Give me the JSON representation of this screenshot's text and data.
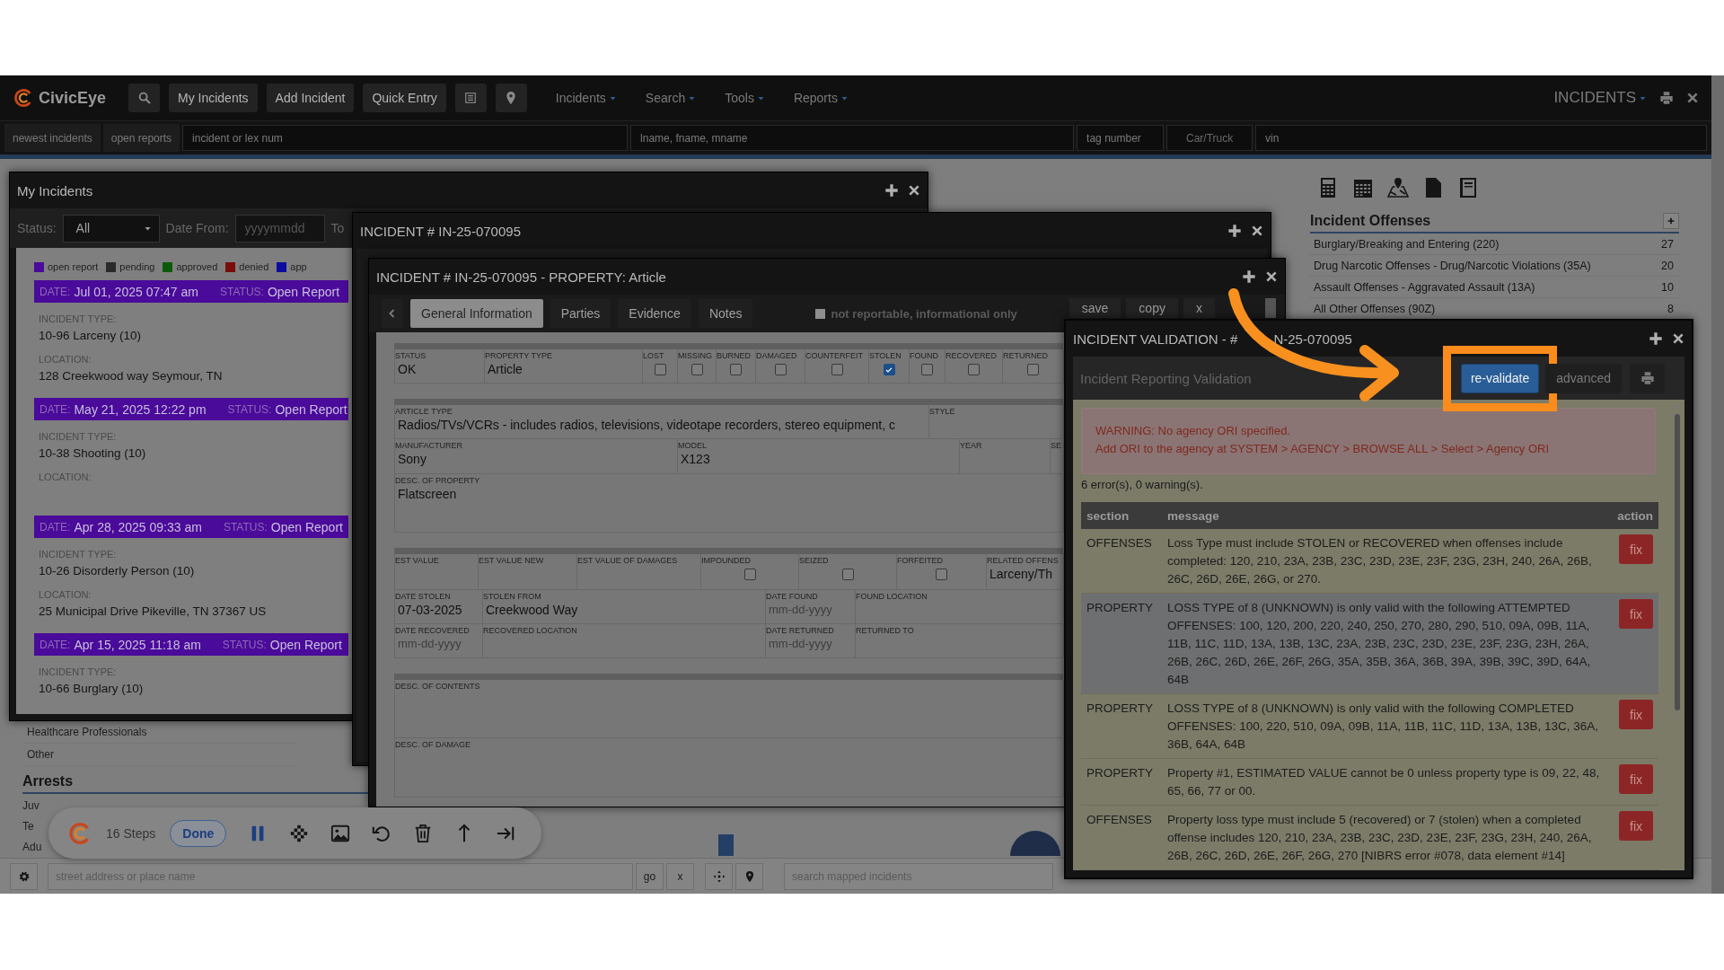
{
  "top_bar": {
    "logo": "CivicEye",
    "buttons": [
      "My Incidents",
      "Add Incident",
      "Quick Entry"
    ],
    "menus": [
      "Incidents",
      "Search",
      "Tools",
      "Reports"
    ],
    "module": "INCIDENTS"
  },
  "search_bar": [
    {
      "kind": "button",
      "label": "newest incidents"
    },
    {
      "kind": "button",
      "label": "open reports"
    },
    {
      "kind": "field",
      "placeholder": "incident or lex num"
    },
    {
      "kind": "field",
      "placeholder": "lname, fname, mname"
    },
    {
      "kind": "field",
      "placeholder": "tag number"
    },
    {
      "kind": "select",
      "label": "Car/Truck"
    },
    {
      "kind": "field",
      "placeholder": "vin"
    }
  ],
  "my_incidents": {
    "title": "My Incidents",
    "status_label": "Status:",
    "status_value": "All",
    "date_from_label": "Date From:",
    "date_from_placeholder": "yyyymmdd",
    "to_label": "To",
    "legend": [
      {
        "label": "open report",
        "color": "#4a0a9a"
      },
      {
        "label": "pending",
        "color": "#2a2a2a"
      },
      {
        "label": "approved",
        "color": "#0b5a0b"
      },
      {
        "label": "denied",
        "color": "#7a0c0c"
      },
      {
        "label": "app",
        "color": "#0c0ca0"
      }
    ],
    "incidents": [
      {
        "date_label": "DATE:",
        "date": "Jul 01, 2025 07:47 am",
        "status_label": "STATUS:",
        "status": "Open Report",
        "type_label": "INCIDENT TYPE:",
        "type": "10-96 Larceny (10)",
        "location_label": "LOCATION:",
        "location": "128 Creekwood way Seymour, TN"
      },
      {
        "date_label": "DATE:",
        "date": "May 21, 2025 12:22 pm",
        "status_label": "STATUS:",
        "status": "Open Report",
        "type_label": "INCIDENT TYPE:",
        "type": "10-38 Shooting (10)",
        "location_label": "LOCATION:"
      },
      {
        "date_label": "DATE:",
        "date": "Apr 28, 2025 09:33 am",
        "status_label": "STATUS:",
        "status": "Open Report",
        "type_label": "INCIDENT TYPE:",
        "type": "10-26 Disorderly Person (10)",
        "location_label": "LOCATION:",
        "location": "25 Municipal Drive Pikeville, TN 37367 US"
      },
      {
        "date_label": "DATE:",
        "date": "Apr 15, 2025 11:18 am",
        "status_label": "STATUS:",
        "status": "Open Report",
        "type_label": "INCIDENT TYPE:",
        "type": "10-66 Burglary (10)"
      }
    ]
  },
  "incident_window": {
    "title": "INCIDENT # IN-25-070095"
  },
  "property_window": {
    "title": "INCIDENT # IN-25-070095 - PROPERTY: Article",
    "tabs": [
      {
        "label": "General Information",
        "selected": true
      },
      {
        "label": "Parties",
        "selected": false
      },
      {
        "label": "Evidence",
        "selected": false
      },
      {
        "label": "Notes",
        "selected": false
      }
    ],
    "not_reportable": {
      "label": "not reportable, informational only",
      "checked": false
    },
    "actions": [
      "save",
      "copy",
      "x"
    ],
    "sections": [
      {
        "rows": [
          [
            {
              "kind": "text",
              "label": "STATUS",
              "value": "OK"
            },
            {
              "kind": "text",
              "label": "PROPERTY TYPE",
              "value": "Article"
            },
            {
              "kind": "checkbox",
              "label": "LOST",
              "checked": false
            },
            {
              "kind": "checkbox",
              "label": "MISSING",
              "checked": false
            },
            {
              "kind": "checkbox",
              "label": "BURNED",
              "checked": false
            },
            {
              "kind": "checkbox",
              "label": "DAMAGED",
              "checked": false
            },
            {
              "kind": "checkbox",
              "label": "COUNTERFEIT",
              "checked": false
            },
            {
              "kind": "checkbox",
              "label": "STOLEN",
              "checked": true
            },
            {
              "kind": "checkbox",
              "label": "FOUND",
              "checked": false
            },
            {
              "kind": "checkbox",
              "label": "RECOVERED",
              "checked": false
            },
            {
              "kind": "checkbox",
              "label": "RETURNED",
              "checked": false
            }
          ]
        ]
      },
      {
        "rows": [
          [
            {
              "kind": "text",
              "label": "ARTICLE TYPE",
              "value": "Radios/TVs/VCRs - includes radios, televisions, videotape recorders, stereo equipment, c"
            },
            {
              "kind": "text",
              "label": "STYLE"
            }
          ],
          [
            {
              "kind": "text",
              "label": "MANUFACTURER",
              "value": "Sony"
            },
            {
              "kind": "text",
              "label": "MODEL",
              "value": "X123"
            },
            {
              "kind": "text",
              "label": "YEAR"
            },
            {
              "kind": "text",
              "label": "SE"
            }
          ],
          [
            {
              "kind": "text",
              "label": "DESC. OF PROPERTY",
              "value": "Flatscreen"
            }
          ]
        ]
      },
      {
        "rows": [
          [
            {
              "kind": "text",
              "label": "EST VALUE"
            },
            {
              "kind": "text",
              "label": "EST VALUE NEW"
            },
            {
              "kind": "text",
              "label": "EST VALUE OF DAMAGES"
            },
            {
              "kind": "checkbox",
              "label": "IMPOUNDED",
              "checked": false
            },
            {
              "kind": "checkbox",
              "label": "SEIZED",
              "checked": false
            },
            {
              "kind": "checkbox",
              "label": "FORFEITED",
              "checked": false
            },
            {
              "kind": "text",
              "label": "RELATED OFFENS",
              "value": "Larceny/Th"
            }
          ],
          [
            {
              "kind": "text",
              "label": "DATE STOLEN",
              "value": "07-03-2025"
            },
            {
              "kind": "text",
              "label": "STOLEN FROM",
              "value": "Creekwood Way"
            },
            {
              "kind": "text",
              "label": "DATE FOUND",
              "placeholder": "mm-dd-yyyy"
            },
            {
              "kind": "text",
              "label": "FOUND LOCATION"
            }
          ],
          [
            {
              "kind": "text",
              "label": "DATE RECOVERED",
              "placeholder": "mm-dd-yyyy"
            },
            {
              "kind": "text",
              "label": "RECOVERED LOCATION"
            },
            {
              "kind": "text",
              "label": "DATE RETURNED",
              "placeholder": "mm-dd-yyyy"
            },
            {
              "kind": "text",
              "label": "RETURNED TO"
            }
          ]
        ]
      },
      {
        "rows": [
          [
            {
              "kind": "text",
              "label": "DESC. OF CONTENTS"
            }
          ],
          [
            {
              "kind": "text",
              "label": "DESC. OF DAMAGE"
            }
          ]
        ]
      }
    ]
  },
  "validation_window": {
    "title": [
      "INCIDENT VALIDATION - #",
      "N-25-070095"
    ],
    "subtitle": "Incident Reporting Validation",
    "buttons": [
      {
        "label": "re-validate",
        "kind": "primary",
        "highlighted": true
      },
      {
        "label": "advanced",
        "kind": "default",
        "highlighted": false
      }
    ],
    "warning": [
      "WARNING: No agency ORI specified.",
      "Add ORI to the agency at SYSTEM > AGENCY > BROWSE ALL > Select > Agency ORI"
    ],
    "summary": "6 error(s), 0 warning(s).",
    "columns": [
      "section",
      "message",
      "action"
    ],
    "rows": [
      {
        "section": "OFFENSES",
        "message": "Loss Type must include STOLEN or RECOVERED when offenses include completed: 120, 210, 23A, 23B, 23C, 23D, 23E, 23F, 23G, 23H, 240, 26A, 26B, 26C, 26D, 26E, 26G, or 270.",
        "action": "fix",
        "highlighted": false
      },
      {
        "section": "PROPERTY",
        "message": "LOSS TYPE of 8 (UNKNOWN) is only valid with the following ATTEMPTED OFFENSES: 100, 120, 200, 220, 240, 250, 270, 280, 290, 510, 09A, 09B, 11A, 11B, 11C, 11D, 13A, 13B, 13C, 23A, 23B, 23C, 23D, 23E, 23F, 23G, 23H, 26A, 26B, 26C, 26D, 26E, 26F, 26G, 35A, 35B, 36A, 36B, 39A, 39B, 39C, 39D, 64A, 64B",
        "action": "fix",
        "highlighted": true
      },
      {
        "section": "PROPERTY",
        "message": "LOSS TYPE of 8 (UNKNOWN) is only valid with the following COMPLETED OFFENSES: 100, 220, 510, 09A, 09B, 11A, 11B, 11C, 11D, 13A, 13B, 13C, 36A, 36B, 64A, 64B",
        "action": "fix",
        "highlighted": false
      },
      {
        "section": "PROPERTY",
        "message": "Property #1, ESTIMATED VALUE cannot be 0 unless property type is 09, 22, 48, 65, 66, 77 or 00.",
        "action": "fix",
        "highlighted": false
      },
      {
        "section": "OFFENSES",
        "message": "Property loss type must include 5 (recovered) or 7 (stolen) when a completed offense includes 120, 210, 23A, 23B, 23C, 23D, 23E, 23F, 23G, 23H, 240, 26A, 26B, 26C, 26D, 26E, 26F, 26G, 270 [NIBRS error #078, data element #14]",
        "action": "fix",
        "highlighted": false
      }
    ]
  },
  "incident_offenses": {
    "title": "Incident Offenses",
    "rows": [
      {
        "label": "Burglary/Breaking and Entering (220)",
        "count": "27"
      },
      {
        "label": "Drug Narcotic Offenses - Drug/Narcotic Violations (35A)",
        "count": "20"
      },
      {
        "label": "Assault Offenses - Aggravated Assault (13A)",
        "count": "10"
      },
      {
        "label": "All Other Offenses (90Z)",
        "count": "8"
      }
    ]
  },
  "side_list": {
    "items": [
      "Healthcare Professionals",
      "Other"
    ],
    "arrests_title": "Arrests",
    "arrests_items": [
      "Juv",
      "Te",
      "Adu"
    ]
  },
  "tutorial_toolbar": {
    "steps": "16 Steps",
    "done": "Done"
  },
  "bottom_bar": {
    "address_placeholder": "street address or place name",
    "go": "go",
    "clear": "x",
    "search_placeholder": "search mapped incidents"
  }
}
